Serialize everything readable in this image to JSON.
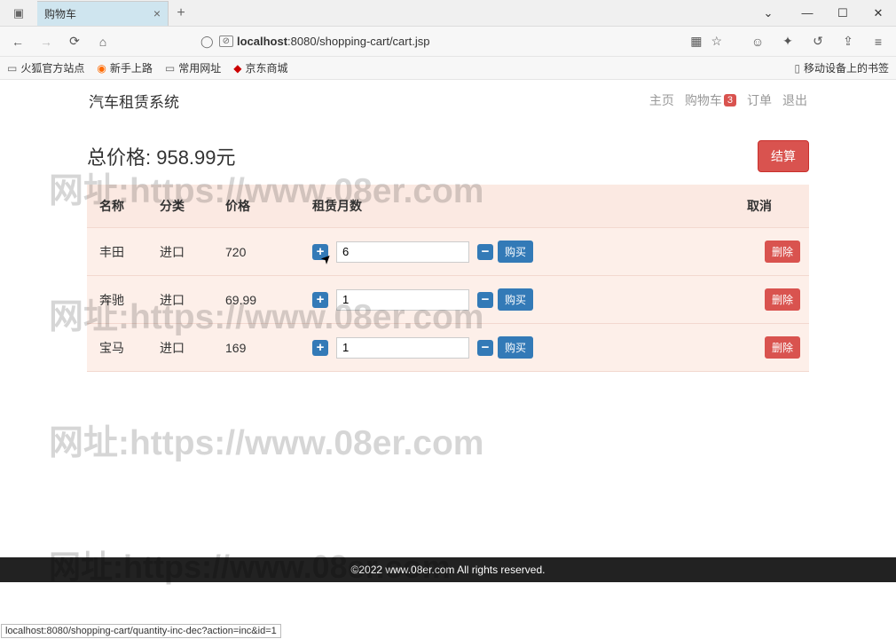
{
  "browser": {
    "tab_title": "购物车",
    "url_host": "localhost",
    "url_path": ":8080/shopping-cart/cart.jsp",
    "status_bar": "localhost:8080/shopping-cart/quantity-inc-dec?action=inc&id=1"
  },
  "bookmarks": {
    "b1": "火狐官方站点",
    "b2": "新手上路",
    "b3": "常用网址",
    "b4": "京东商城",
    "right": "移动设备上的书签"
  },
  "header": {
    "brand": "汽车租赁系统",
    "nav_home": "主页",
    "nav_cart": "购物车",
    "cart_count": "3",
    "nav_order": "订单",
    "nav_logout": "退出"
  },
  "total": {
    "label": "总价格: 958.99元",
    "checkout": "结算"
  },
  "table": {
    "th_name": "名称",
    "th_cat": "分类",
    "th_price": "价格",
    "th_qty": "租赁月数",
    "th_cancel": "取消",
    "buy_label": "购买",
    "del_label": "删除",
    "rows": [
      {
        "name": "丰田",
        "cat": "进口",
        "price": "720",
        "qty": "6"
      },
      {
        "name": "奔驰",
        "cat": "进口",
        "price": "69.99",
        "qty": "1"
      },
      {
        "name": "宝马",
        "cat": "进口",
        "price": "169",
        "qty": "1"
      }
    ]
  },
  "watermark": "网址:https://www.08er.com",
  "footer": "©2022 www.08er.com All rights reserved."
}
